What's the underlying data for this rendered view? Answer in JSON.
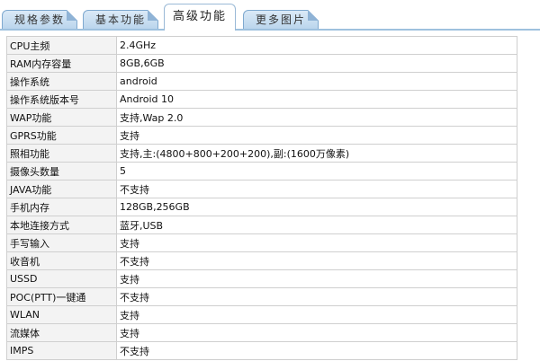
{
  "tabs": [
    {
      "label": "规格参数",
      "active": false
    },
    {
      "label": "基本功能",
      "active": false
    },
    {
      "label": "高级功能",
      "active": true
    },
    {
      "label": "更多图片",
      "active": false
    }
  ],
  "specs": [
    {
      "key": "CPU主频",
      "value": "2.4GHz"
    },
    {
      "key": "RAM内存容量",
      "value": "8GB,6GB"
    },
    {
      "key": "操作系统",
      "value": "android"
    },
    {
      "key": "操作系统版本号",
      "value": "Android 10"
    },
    {
      "key": "WAP功能",
      "value": "支持,Wap 2.0"
    },
    {
      "key": "GPRS功能",
      "value": "支持"
    },
    {
      "key": "照相功能",
      "value": "支持,主:(4800+800+200+200),副:(1600万像素)"
    },
    {
      "key": "摄像头数量",
      "value": "5"
    },
    {
      "key": "JAVA功能",
      "value": "不支持"
    },
    {
      "key": "手机内存",
      "value": "128GB,256GB"
    },
    {
      "key": "本地连接方式",
      "value": "蓝牙,USB"
    },
    {
      "key": "手写输入",
      "value": "支持"
    },
    {
      "key": "收音机",
      "value": "不支持"
    },
    {
      "key": "USSD",
      "value": "支持"
    },
    {
      "key": "POC(PTT)一键通",
      "value": "不支持"
    },
    {
      "key": "WLAN",
      "value": "支持"
    },
    {
      "key": "流媒体",
      "value": "支持"
    },
    {
      "key": "IMPS",
      "value": "不支持"
    }
  ]
}
